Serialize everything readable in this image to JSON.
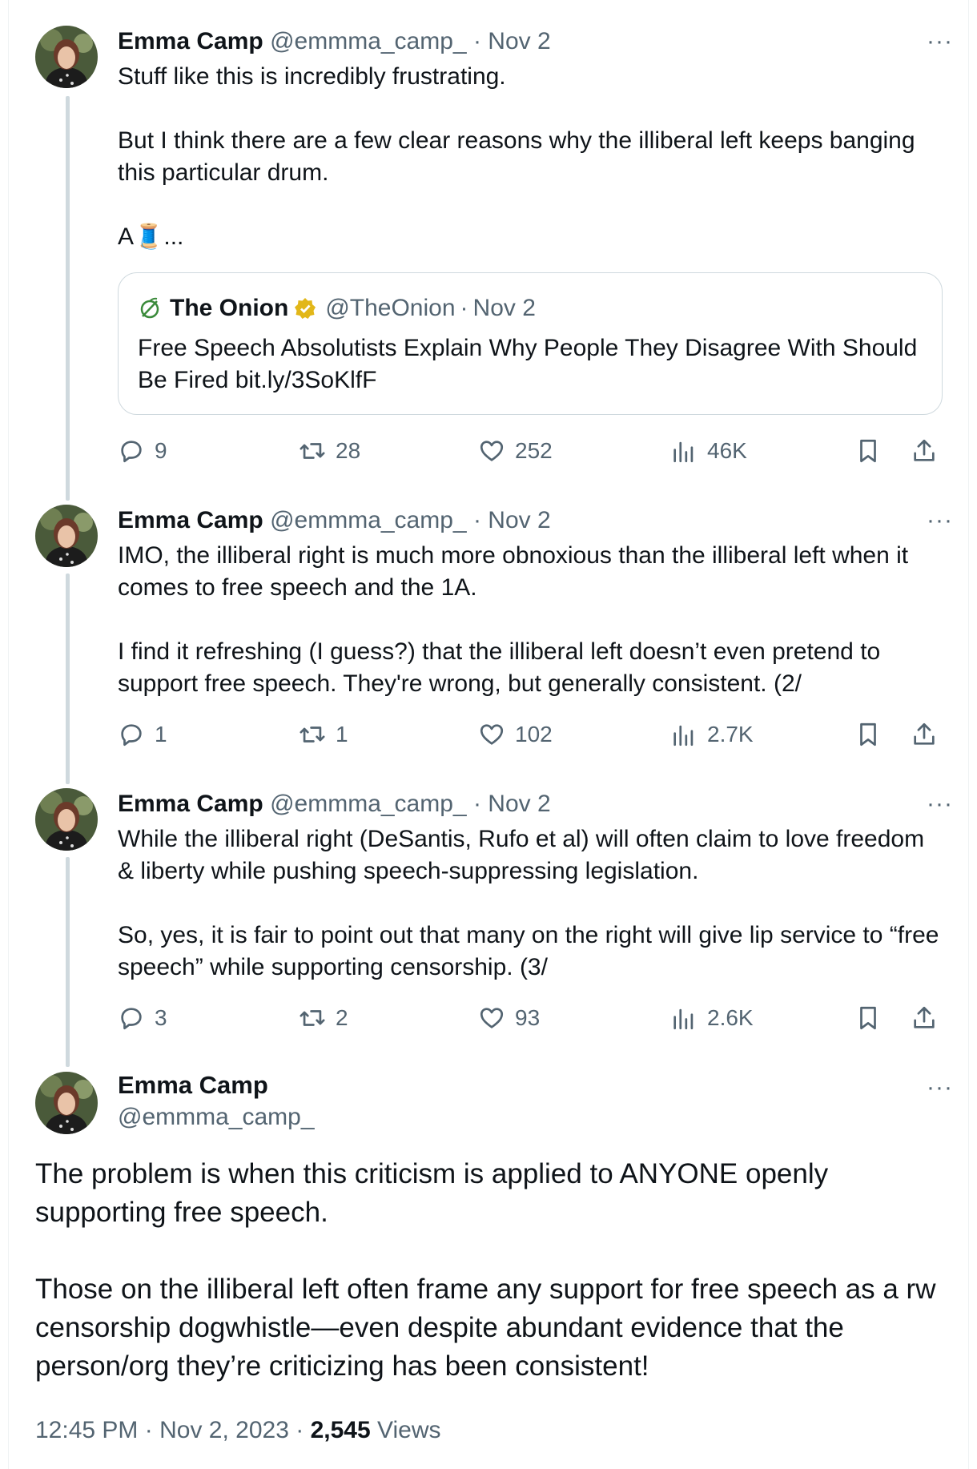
{
  "colors": {
    "text": "#0f1419",
    "muted": "#536471",
    "border": "#cfd9de",
    "verified": "#e2b719",
    "onion_green": "#3a8a3a"
  },
  "tweets": [
    {
      "name": "Emma Camp",
      "handle": "@emmma_camp_",
      "separator": "·",
      "date": "Nov 2",
      "more": "···",
      "text": "Stuff like this is incredibly frustrating.\n\nBut I think there are a few clear reasons why the illiberal left keeps banging this particular drum.\n\nA🧵...",
      "quote": {
        "name": "The Onion",
        "handle": "@TheOnion",
        "date": "Nov 2",
        "text": "Free Speech Absolutists Explain Why People They Disagree With Should Be Fired bit.ly/3SoKlfF"
      },
      "replies": "9",
      "reposts": "28",
      "likes": "252",
      "views": "46K"
    },
    {
      "name": "Emma Camp",
      "handle": "@emmma_camp_",
      "separator": "·",
      "date": "Nov 2",
      "more": "···",
      "text": "IMO, the illiberal right is much more obnoxious than the illiberal left when it comes to free speech and the 1A.\n\nI find it refreshing (I guess?) that the illiberal left doesn’t even pretend to support free speech. They're wrong, but generally consistent. (2/",
      "replies": "1",
      "reposts": "1",
      "likes": "102",
      "views": "2.7K"
    },
    {
      "name": "Emma Camp",
      "handle": "@emmma_camp_",
      "separator": "·",
      "date": "Nov 2",
      "more": "···",
      "text": "While the illiberal right (DeSantis, Rufo et al) will often claim to love freedom & liberty while pushing speech-suppressing legislation.\n\nSo, yes, it is fair to point out that many on the right will give lip service to “free speech” while supporting censorship. (3/",
      "replies": "3",
      "reposts": "2",
      "likes": "93",
      "views": "2.6K"
    }
  ],
  "main": {
    "name": "Emma Camp",
    "handle": "@emmma_camp_",
    "more": "···",
    "text": "The problem is when this criticism is applied to ANYONE openly supporting free speech.\n\nThose on the illiberal left often frame any support for free speech as a rw censorship dogwhistle—even despite abundant evidence that the person/org they’re criticizing has been consistent!",
    "time": "12:45 PM",
    "date": "Nov 2, 2023",
    "separator": "·",
    "views_count": "2,545",
    "views_label": "Views"
  }
}
